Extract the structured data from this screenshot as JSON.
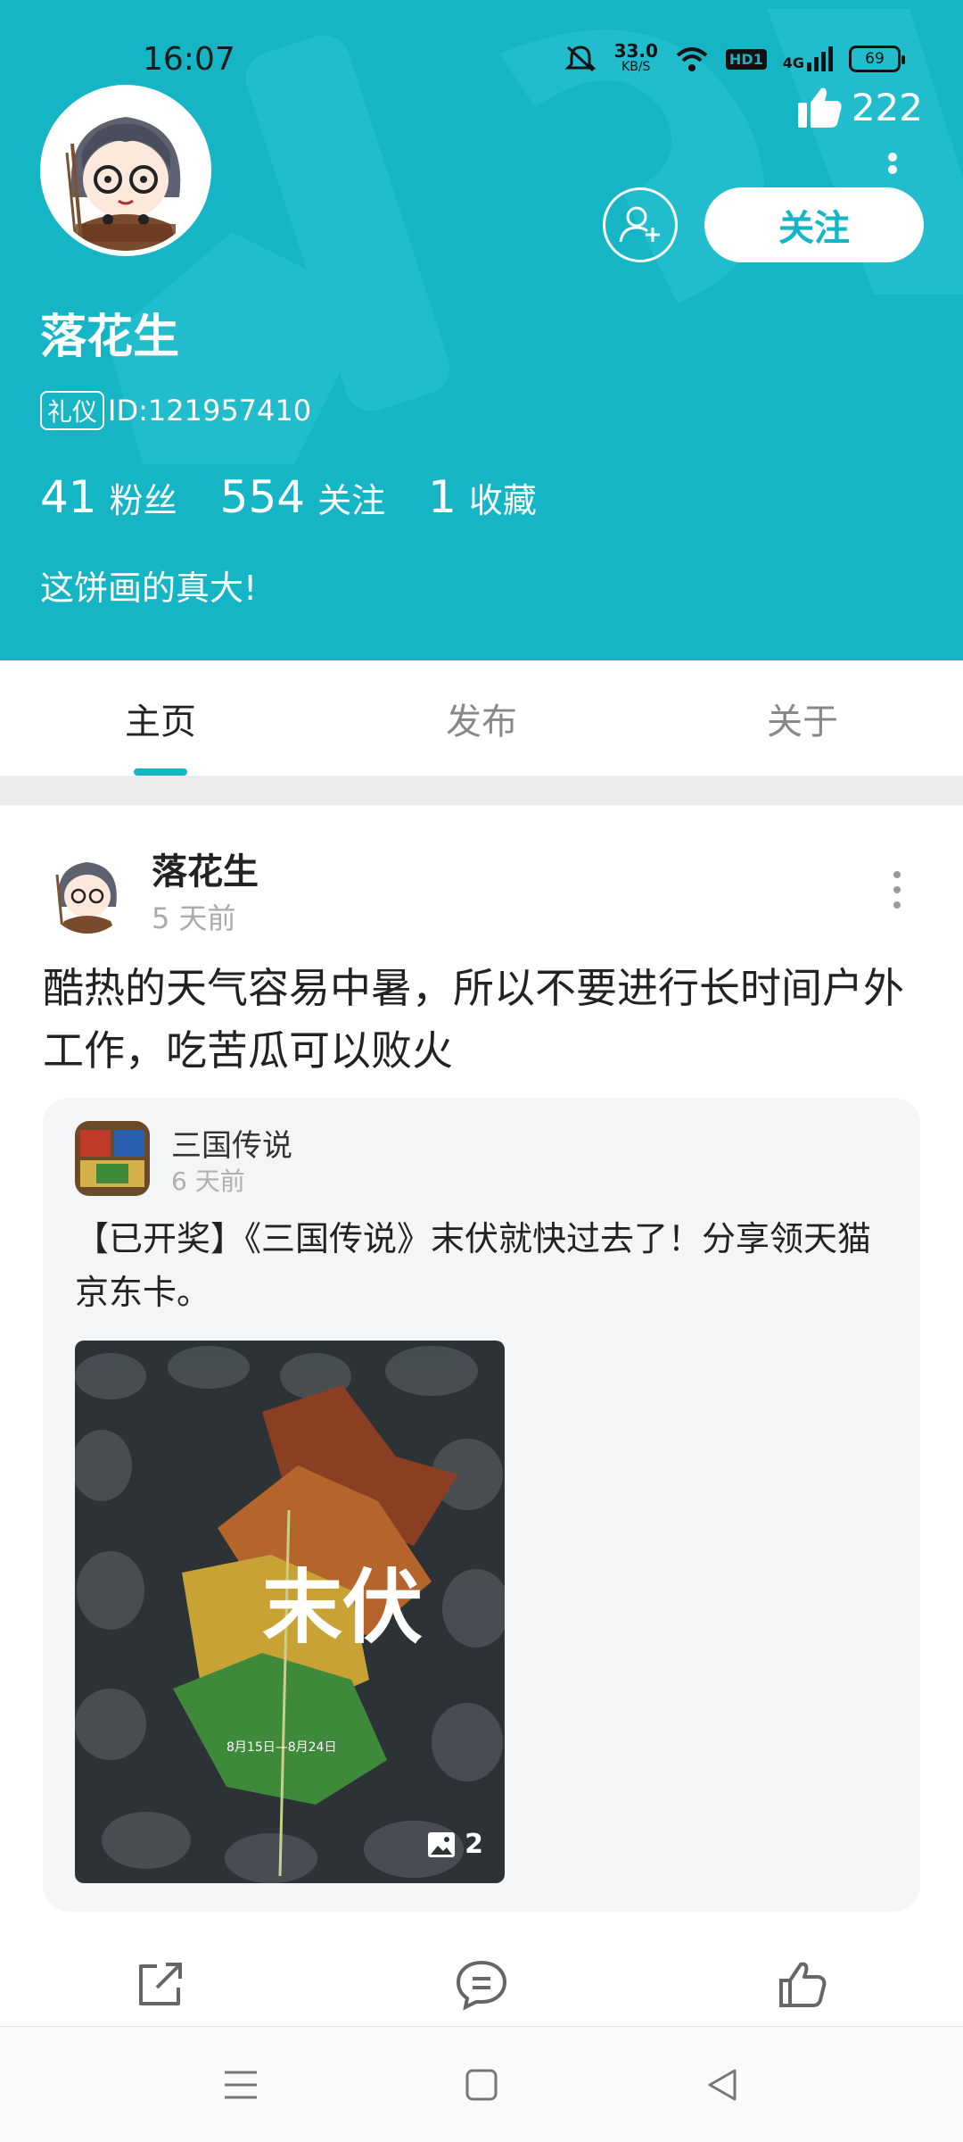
{
  "status_bar": {
    "time": "16:07",
    "net_speed": "33.0",
    "net_unit": "KB/S",
    "hd_label": "HD1",
    "signal_label": "4G",
    "battery": "69"
  },
  "profile": {
    "name": "落花生",
    "badge": "礼仪",
    "id_text": "ID:121957410",
    "likes": "222",
    "follow_label": "关注",
    "stats": [
      {
        "num": "41",
        "label": "粉丝"
      },
      {
        "num": "554",
        "label": "关注"
      },
      {
        "num": "1",
        "label": "收藏"
      }
    ],
    "bio": "这饼画的真大!"
  },
  "tabs": [
    {
      "label": "主页",
      "active": true
    },
    {
      "label": "发布",
      "active": false
    },
    {
      "label": "关于",
      "active": false
    }
  ],
  "post": {
    "author": "落花生",
    "time": "5 天前",
    "text": "酷热的天气容易中暑，所以不要进行长时间户外工作，吃苦瓜可以败火",
    "shared": {
      "game_name": "三国传说",
      "time": "6 天前",
      "text": "【已开奖】《三国传说》末伏就快过去了！分享领天猫京东卡。",
      "image_title": "末伏",
      "image_dates": "8月15日—8月24日",
      "image_count": "2"
    }
  },
  "colors": {
    "accent": "#15b5c5",
    "text_primary": "#222222",
    "text_muted": "#aaaaaa"
  },
  "icons": {
    "like": "thumbs-up-icon",
    "add_friend": "add-user-icon",
    "share": "share-icon",
    "comment": "comment-icon",
    "image": "image-icon"
  }
}
